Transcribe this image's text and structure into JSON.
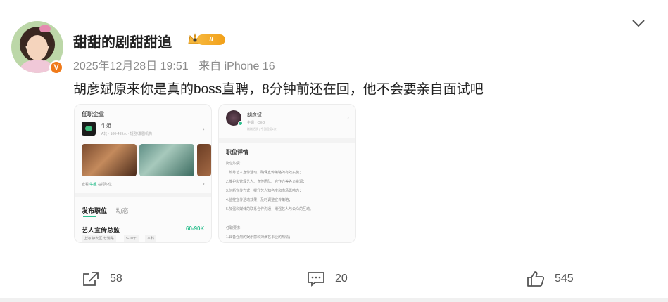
{
  "post": {
    "username": "甜甜的剧甜甜追",
    "level_badge": "II",
    "verified_badge": "V",
    "date": "2025年12月28日 19:51",
    "source": "来自 iPhone 16",
    "text": "胡彦斌原来你是真的boss直聘，8分钟前还在回，他不会要亲自面试吧"
  },
  "image1": {
    "section_title": "任职企业",
    "company_name": "牛姐",
    "company_sub": "A轮 · 100-499人 · 短剧/漫剧机构",
    "location_pre": "查看",
    "location_hl": "牛姐",
    "location_post": "在招职位",
    "tab_active": "发布职位",
    "tab_inactive": "动态",
    "job_title": "艺人宣传总监",
    "salary": "60-90K",
    "tags": [
      "上海 静安区 七浦路",
      "5-10年",
      "本科"
    ]
  },
  "image2": {
    "name": "胡彦斌",
    "sub": "牛姐 · CEO",
    "sub2": "刚刚活跃 | 今日回复1次",
    "section_title": "职位详情",
    "lines": [
      "岗位职责：",
      "1.统筹艺人宣传活动，确保宣传策略的有效实施；",
      "2.维护和管理艺人、宣传团队、合作方等各方资源；",
      "3.创新宣传方式，提升艺人知名度和市场影响力；",
      "4.监控宣传活动效果，及时调整宣传策略；",
      "5.加强和媒体的联系合作沟通，增强艺人与公众的互动。",
      "",
      "任职要求：",
      "1.具备强烈的娱乐感和对演艺事业的热情；"
    ]
  },
  "actions": {
    "share_count": "58",
    "comment_count": "20",
    "like_count": "545"
  },
  "icons": [
    "chevron-down-icon",
    "crown-icon",
    "share-icon",
    "comment-icon",
    "like-icon"
  ],
  "colors": {
    "accent": "#2fbf8f",
    "level_badge": "#f2a019",
    "verified": "#f07a1a"
  }
}
